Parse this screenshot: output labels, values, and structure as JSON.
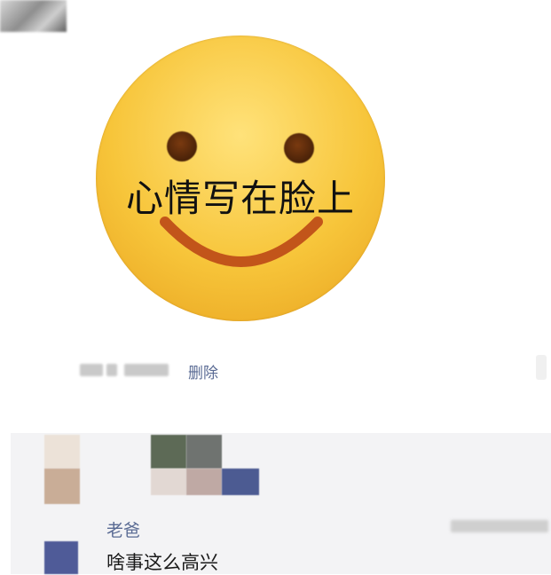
{
  "post": {
    "emoji_caption": "心情写在脸上",
    "delete_label": "删除"
  },
  "comment": {
    "author": "老爸",
    "text": "啥事这么高兴"
  },
  "colors": {
    "link": "#5a6b94",
    "emoji_yellow": "#f7c53a"
  }
}
